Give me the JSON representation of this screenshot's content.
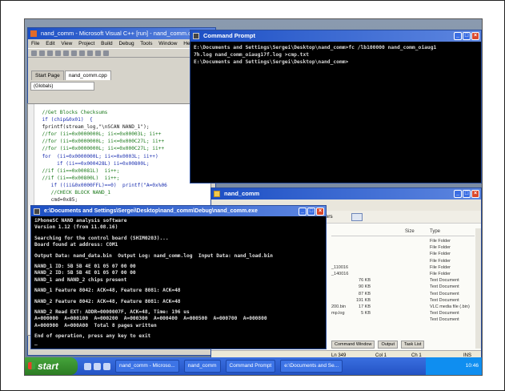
{
  "vc": {
    "title": "nand_comm - Microsoft Visual C++ [run] - nand_comm.cpp",
    "menu": [
      "File",
      "Edit",
      "View",
      "Project",
      "Build",
      "Debug",
      "Tools",
      "Window",
      "He"
    ],
    "tabs": [
      "Start Page",
      "nand_comm.cpp"
    ],
    "scope": "(Globals)",
    "code": [
      {
        "t": "  //Get Blocks Checksums",
        "c": "cm"
      },
      {
        "t": "  if (chip&0x01)  {",
        "c": "kw"
      },
      {
        "t": "  fprintf(stream_log,\"\\nSCAN NAND_1\");",
        "c": ""
      },
      {
        "t": "  //for (ii=0x0000000L; ii<=0x00003L; ii++",
        "c": "cm"
      },
      {
        "t": "  //for (ii=0x0000000L; ii<=0x000C27L; ii++",
        "c": "cm"
      },
      {
        "t": "  //for (ii=0x0000000L; ii<=0x000C27L; ii++",
        "c": "cm"
      },
      {
        "t": "  for  (ii=0x0000000L; ii<=0x0003L; ii++)",
        "c": "kw"
      },
      {
        "t": "       if (ii==0x000428L) ii=0x00800L;",
        "c": "kw"
      },
      {
        "t": "  //if (ii==0x00081L)  ii++;",
        "c": "cm"
      },
      {
        "t": "  //if (ii==0x00800L)  ii++;",
        "c": "cm"
      },
      {
        "t": "     if ((ii&0x0000FFL)==0)  printf(\"A=0x%06",
        "c": "kw"
      },
      {
        "t": "     //CHECK BLOCK NAND_1",
        "c": "cm"
      },
      {
        "t": "     cmd=0x85;",
        "c": ""
      }
    ]
  },
  "cmd": {
    "title": "Command Prompt",
    "lines": [
      "E:\\Documents and Settings\\Sergei\\Desktop\\nand_comm>fc /lb100000 nand_comm_oiaug1",
      "7h.log nand_comm_oiaug17f.log >cmp.txt",
      "",
      "E:\\Documents and Settings\\Sergei\\Desktop\\nand_comm>"
    ]
  },
  "explorer": {
    "title": "nand_comm",
    "folders_label": "Folders",
    "header_size": "Size",
    "header_type": "Type",
    "rows": [
      {
        "name": "",
        "size": "",
        "type": "File Folder"
      },
      {
        "name": "",
        "size": "",
        "type": "File Folder"
      },
      {
        "name": "",
        "size": "",
        "type": "File Folder"
      },
      {
        "name": "",
        "size": "",
        "type": "File Folder"
      },
      {
        "name": "_110016",
        "size": "",
        "type": "File Folder"
      },
      {
        "name": "_140016",
        "size": "",
        "type": "File Folder"
      },
      {
        "name": "",
        "size": "76 KB",
        "type": "Text Document"
      },
      {
        "name": "",
        "size": "90 KB",
        "type": "Text Document"
      },
      {
        "name": "",
        "size": "87 KB",
        "type": "Text Document"
      },
      {
        "name": "",
        "size": "191 KB",
        "type": "Text Document"
      },
      {
        "name": "200.bin",
        "size": "17 KB",
        "type": "VLC media file (.bin)"
      },
      {
        "name": "mp.log",
        "size": "5 KB",
        "type": "Text Document"
      },
      {
        "name": "",
        "size": "",
        "type": "Text Document"
      }
    ],
    "dock_tabs": [
      "Command Window",
      "Output",
      "Task List"
    ],
    "status": {
      "ln": "Ln 349",
      "col": "Col 1",
      "ch": "Ch 1",
      "mode": "INS"
    }
  },
  "dbg": {
    "title": "e:\\Documents and Settings\\Sergei\\Desktop\\nand_comm\\Debug\\nand_comm.exe",
    "lines": [
      "iPhoneSC NAND analysis software",
      "Version 1.12 (from 11.08.16)",
      "",
      "Searching for the control board (SHIM0203)...",
      "Board found at address: COM1",
      "",
      "Output Data: nand_data.bin  Output Log: nand_comm.log  Input Data: nand_load.bin",
      "",
      "NAND_1 ID: 5B 5B 4E 01 05 07 00 00",
      "NAND_2 ID: 5B 5B 4E 01 05 07 00 00",
      "NAND_1 and NAND_2 chips present",
      "",
      "NAND_1 Feature 8042: ACK=48, Feature 8081: ACK=48",
      "",
      "NAND_2 Feature 8042: ACK=48, Feature 8081: ACK=48",
      "",
      "NAND_2 Read EXT: ADDR=0000007F, ACK=48, Time: 196 us",
      "A=000000  A=000100  A=000200  A=000300  A=000400  A=000500  A=000700  A=000800",
      "A=000900  A=000A00  Total 8 pages written",
      "",
      "End of operation, press any key to exit",
      "_"
    ]
  },
  "taskbar": {
    "start": "start",
    "buttons": [
      "nand_comm - Microso...",
      "nand_comm",
      "Command Prompt",
      "e:\\Documents and Se..."
    ],
    "clock": "10:46"
  }
}
